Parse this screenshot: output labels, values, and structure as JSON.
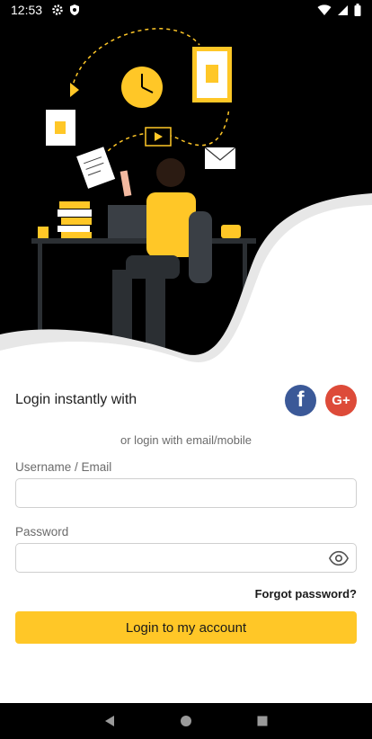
{
  "status_bar": {
    "time": "12:53",
    "icons": [
      "gear-icon",
      "shield-icon",
      "wifi-icon",
      "signal-icon",
      "battery-icon"
    ]
  },
  "login_instant": {
    "label": "Login instantly with",
    "facebook": {
      "glyph": "f",
      "color": "#3b5998"
    },
    "google": {
      "glyph": "G+",
      "color": "#dd4b39"
    }
  },
  "alt_login_text": "or login with email/mobile",
  "form": {
    "username_label": "Username / Email",
    "username_value": "",
    "password_label": "Password",
    "password_value": "",
    "forgot_password": "Forgot password?",
    "submit_label": "Login to my account"
  },
  "colors": {
    "accent": "#ffc727",
    "hero_background": "#000000"
  },
  "nav_bar": {
    "buttons": [
      "back-icon",
      "home-icon",
      "recents-icon"
    ]
  }
}
